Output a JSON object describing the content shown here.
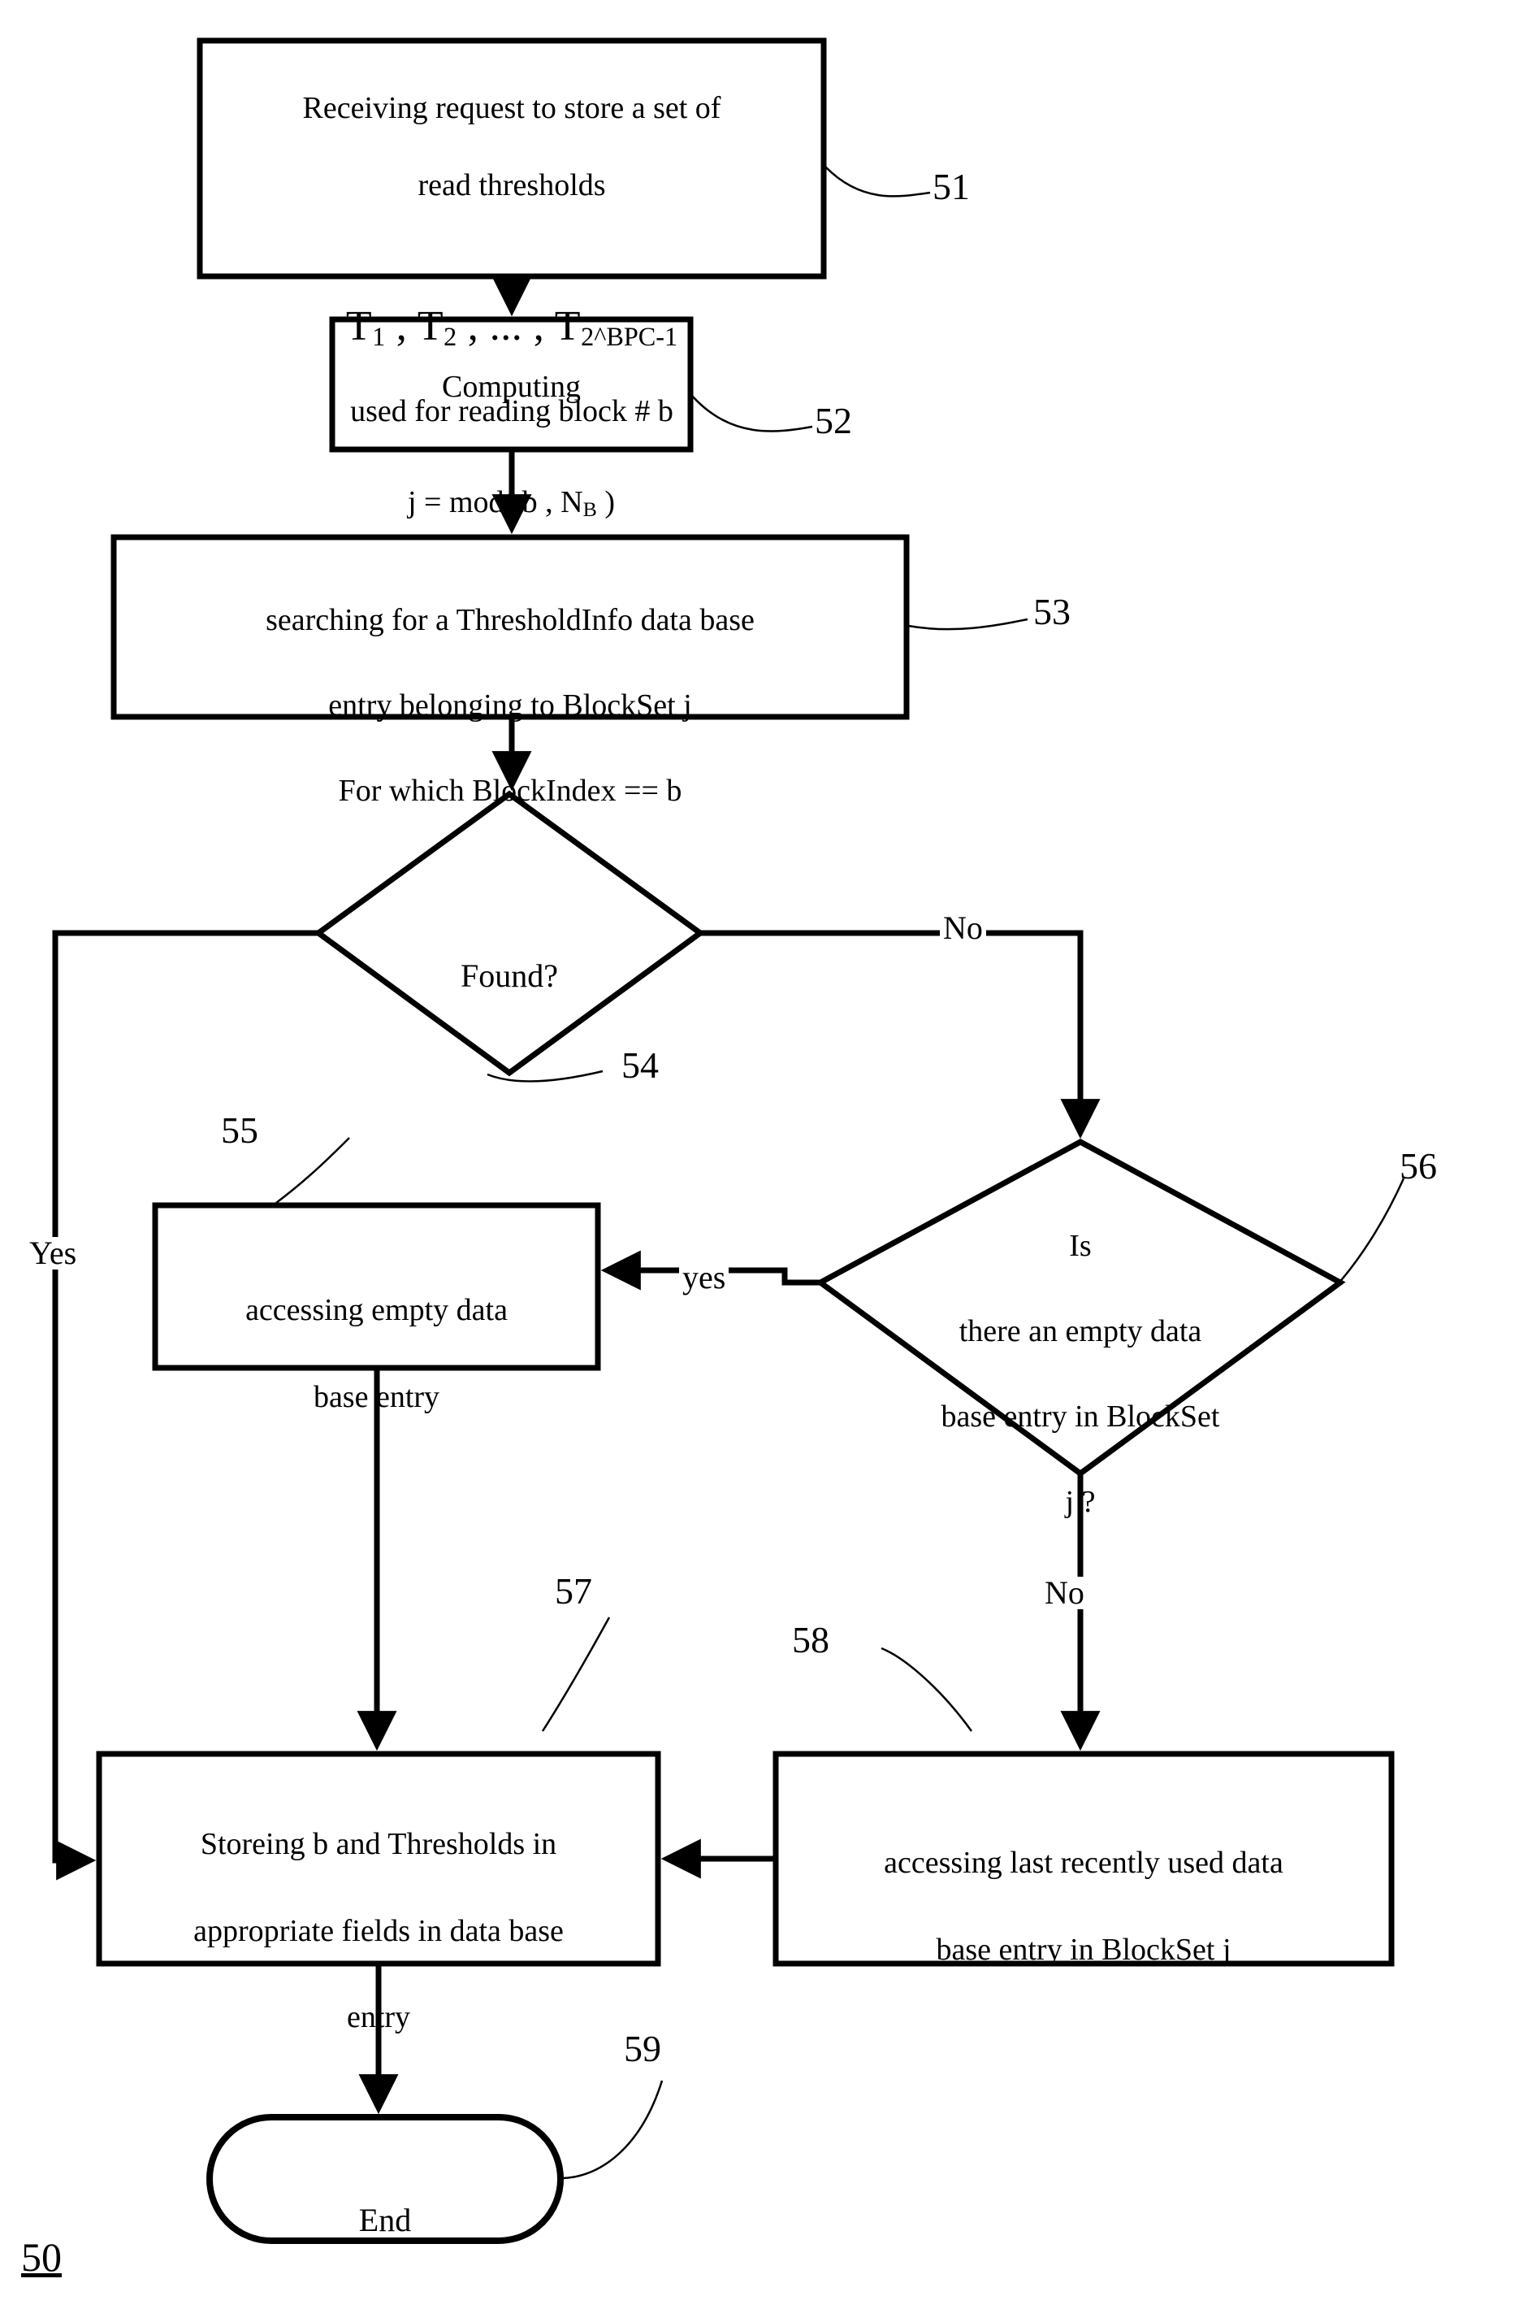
{
  "figure": {
    "id_label": "50",
    "background_color": "#ffffff",
    "line_color": "#000000"
  },
  "nodes": {
    "receive": {
      "ref": "51",
      "shape": "process",
      "line1": "Receiving request to store a set of",
      "line2": "read thresholds",
      "formula_t1": "T",
      "formula_t1_sub": "1",
      "formula_sep1": " , ",
      "formula_t2": "T",
      "formula_t2_sub": "2",
      "formula_sep2": " , ... , ",
      "formula_t3": "T",
      "formula_t3_sub_main": "2",
      "formula_t3_sub_rest": "^BPC-1",
      "line4": "used for reading block # b"
    },
    "computing": {
      "ref": "52",
      "shape": "process",
      "line1": "Computing",
      "formula_lhs": "j = mod( b , N",
      "formula_sub": "B",
      "formula_rhs": " )"
    },
    "searching": {
      "ref": "53",
      "shape": "process",
      "line1": "searching for a ThresholdInfo data base",
      "line2": "entry belonging to BlockSet j",
      "line3": "For which BlockIndex == b"
    },
    "found": {
      "ref": "54",
      "shape": "decision",
      "text": "Found?"
    },
    "access_empty": {
      "ref": "55",
      "shape": "process",
      "line1": "accessing empty data",
      "line2": "base entry"
    },
    "is_empty": {
      "ref": "56",
      "shape": "decision",
      "line1": "Is",
      "line2": "there an empty data",
      "line3": "base entry in BlockSet",
      "line4": "j ?"
    },
    "storing": {
      "ref": "57",
      "shape": "process",
      "line1": "Storeing b and Thresholds in",
      "line2": "appropriate fields in data base",
      "line3": "entry"
    },
    "access_lru": {
      "ref": "58",
      "shape": "process",
      "line1": "accessing last recently used data",
      "line2": "base entry in BlockSet j"
    },
    "end": {
      "ref": "59",
      "shape": "terminator",
      "text": "End"
    }
  },
  "edge_labels": {
    "found_no": "No",
    "found_yes": "Yes",
    "is_empty_yes": "yes",
    "is_empty_no": "No"
  }
}
